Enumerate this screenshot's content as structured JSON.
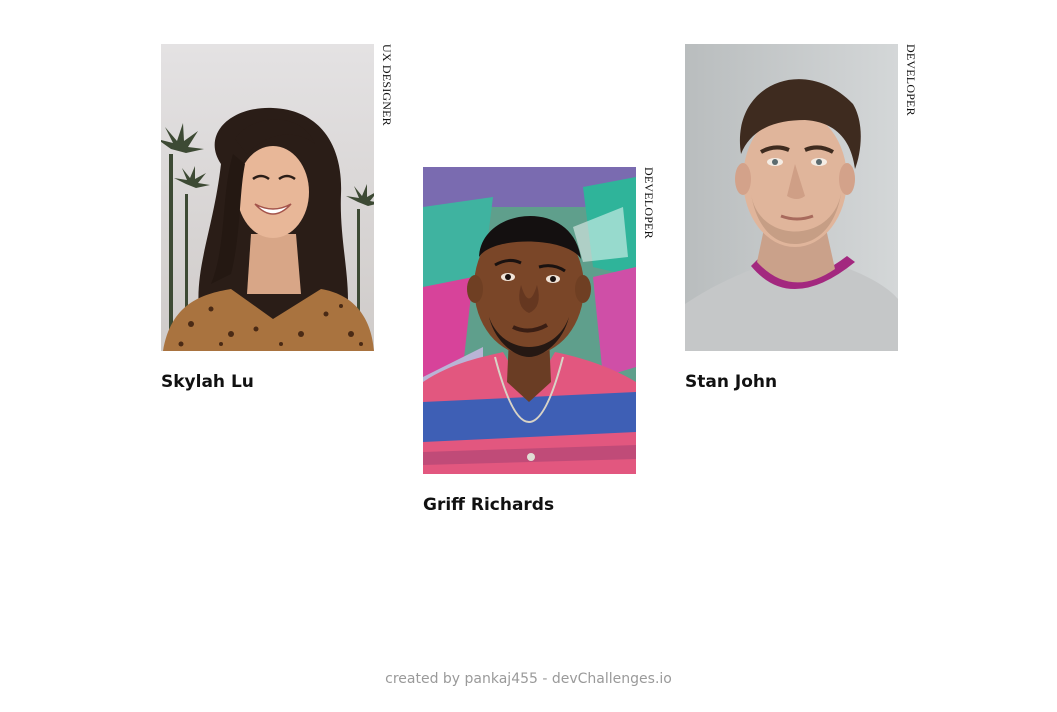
{
  "team": [
    {
      "name": "Skylah Lu",
      "role": "UX DESIGNER"
    },
    {
      "name": "Griff Richards",
      "role": "DEVELOPER"
    },
    {
      "name": "Stan John",
      "role": "DEVELOPER"
    }
  ],
  "footer": {
    "text": "created by pankaj455 - devChallenges.io"
  }
}
